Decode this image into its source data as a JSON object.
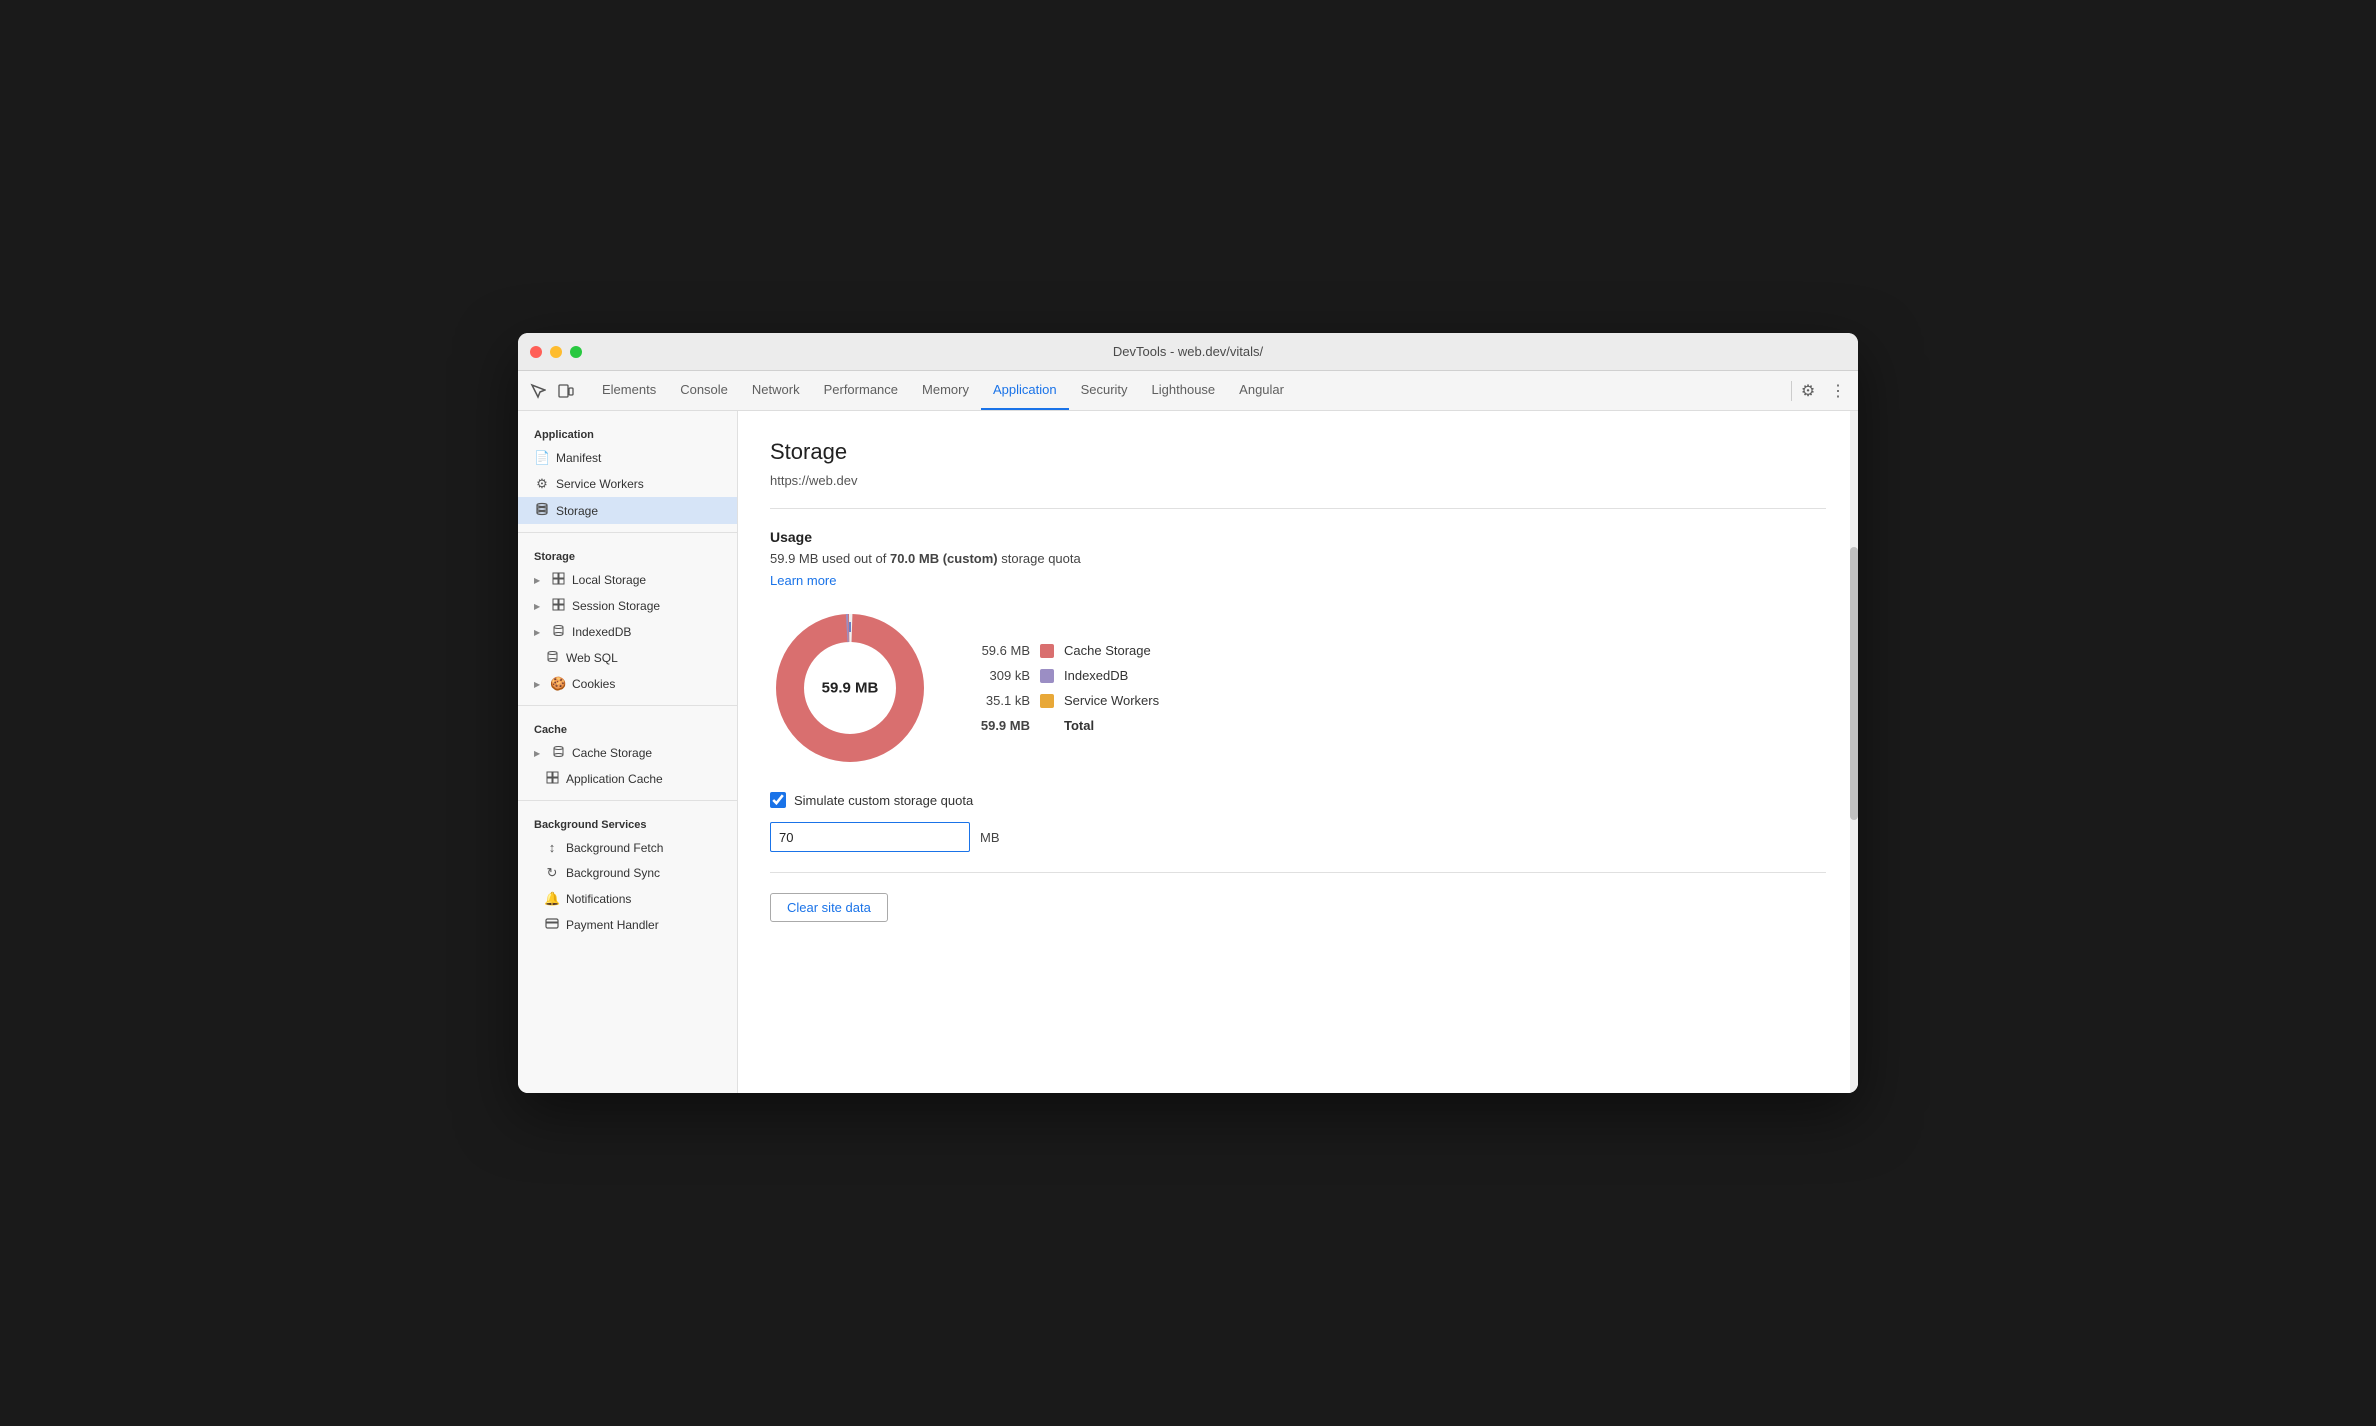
{
  "window": {
    "title": "DevTools - web.dev/vitals/"
  },
  "tabs": [
    {
      "id": "elements",
      "label": "Elements",
      "active": false
    },
    {
      "id": "console",
      "label": "Console",
      "active": false
    },
    {
      "id": "network",
      "label": "Network",
      "active": false
    },
    {
      "id": "performance",
      "label": "Performance",
      "active": false
    },
    {
      "id": "memory",
      "label": "Memory",
      "active": false
    },
    {
      "id": "application",
      "label": "Application",
      "active": true
    },
    {
      "id": "security",
      "label": "Security",
      "active": false
    },
    {
      "id": "lighthouse",
      "label": "Lighthouse",
      "active": false
    },
    {
      "id": "angular",
      "label": "Angular",
      "active": false
    }
  ],
  "sidebar": {
    "application_label": "Application",
    "application_items": [
      {
        "id": "manifest",
        "label": "Manifest",
        "icon": "📄"
      },
      {
        "id": "service-workers",
        "label": "Service Workers",
        "icon": "⚙"
      },
      {
        "id": "storage",
        "label": "Storage",
        "icon": "🗄",
        "selected": true
      }
    ],
    "storage_label": "Storage",
    "storage_items": [
      {
        "id": "local-storage",
        "label": "Local Storage",
        "icon": "▦",
        "expandable": true
      },
      {
        "id": "session-storage",
        "label": "Session Storage",
        "icon": "▦",
        "expandable": true
      },
      {
        "id": "indexeddb",
        "label": "IndexedDB",
        "icon": "🗃",
        "expandable": true
      },
      {
        "id": "web-sql",
        "label": "Web SQL",
        "icon": "🗃",
        "expandable": false
      },
      {
        "id": "cookies",
        "label": "Cookies",
        "icon": "🍪",
        "expandable": true
      }
    ],
    "cache_label": "Cache",
    "cache_items": [
      {
        "id": "cache-storage",
        "label": "Cache Storage",
        "icon": "🗃",
        "expandable": true
      },
      {
        "id": "app-cache",
        "label": "Application Cache",
        "icon": "▦",
        "expandable": false
      }
    ],
    "bg_services_label": "Background Services",
    "bg_services_items": [
      {
        "id": "bg-fetch",
        "label": "Background Fetch",
        "icon": "↕"
      },
      {
        "id": "bg-sync",
        "label": "Background Sync",
        "icon": "↻"
      },
      {
        "id": "notifications",
        "label": "Notifications",
        "icon": "🔔"
      },
      {
        "id": "payment-handler",
        "label": "Payment Handler",
        "icon": "💳"
      }
    ]
  },
  "content": {
    "title": "Storage",
    "url": "https://web.dev",
    "usage_title": "Usage",
    "usage_text_prefix": "59.9 MB used out of ",
    "usage_bold": "70.0 MB (custom)",
    "usage_text_suffix": " storage quota",
    "learn_more": "Learn more",
    "donut_center": "59.9 MB",
    "legend": [
      {
        "value": "59.6 MB",
        "color": "#d96f6f",
        "label": "Cache Storage"
      },
      {
        "value": "309 kB",
        "color": "#9b8ec4",
        "label": "IndexedDB"
      },
      {
        "value": "35.1 kB",
        "color": "#e8a838",
        "label": "Service Workers"
      },
      {
        "value": "59.9 MB",
        "color": "",
        "label": "Total",
        "total": true
      }
    ],
    "checkbox_label": "Simulate custom storage quota",
    "quota_value": "70",
    "quota_unit": "MB",
    "clear_btn": "Clear site data"
  }
}
